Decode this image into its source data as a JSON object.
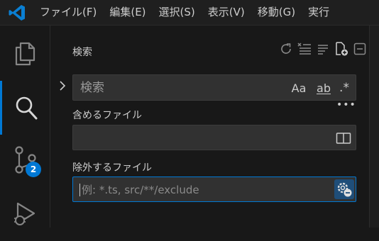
{
  "titlebar": {
    "menu": [
      "ファイル(F)",
      "編集(E)",
      "選択(S)",
      "表示(V)",
      "移動(G)",
      "実行"
    ]
  },
  "activitybar": {
    "items": [
      {
        "icon": "files-icon"
      },
      {
        "icon": "search-icon",
        "active": true
      },
      {
        "icon": "source-control-icon",
        "badge": "2"
      },
      {
        "icon": "run-debug-icon"
      }
    ]
  },
  "search_view": {
    "title": "検索",
    "actions": [
      "refresh-icon",
      "clear-results-icon",
      "collapse-all-icon",
      "new-search-editor-icon",
      "view-as-tree-icon"
    ],
    "search_input": {
      "value": "",
      "placeholder": "検索"
    },
    "options": {
      "match_case": "Aa",
      "whole_word": "ab",
      "regex": ".*"
    },
    "more": "•••",
    "include": {
      "label": "含めるファイル",
      "value": "",
      "placeholder": ""
    },
    "exclude": {
      "label": "除外するファイル",
      "value": "",
      "placeholder": "例: *.ts, src/**/exclude"
    }
  },
  "colors": {
    "accent": "#0078d4",
    "background": "#181818",
    "input": "#313131"
  }
}
